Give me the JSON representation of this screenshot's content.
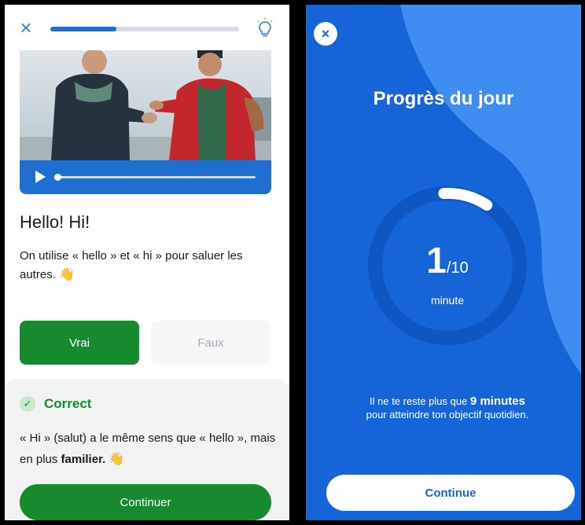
{
  "lesson_screen": {
    "close_icon": "close-icon",
    "progress_fraction": 0.35,
    "hint_icon": "lightbulb-icon",
    "video": {
      "play_icon": "play-icon",
      "seek_fraction": 0.0
    },
    "title": "Hello! Hi!",
    "body_text": "On utilise « hello » et « hi » pour saluer les autres.",
    "body_emoji": "👋",
    "answer_true_label": "Vrai",
    "answer_false_label": "Faux",
    "feedback": {
      "status_label": "Correct",
      "text_before": "« Hi » (salut) a le même sens que « hello », mais en plus ",
      "text_bold": "familier.",
      "emoji": "👋",
      "continue_label": "Continuer"
    },
    "colors": {
      "accent_blue": "#1f6fd1",
      "success_green": "#178a2f"
    }
  },
  "progress_screen": {
    "close_icon": "close-icon",
    "title": "Progrès du jour",
    "current_minutes": "1",
    "goal_minutes_label": "/10",
    "unit_label": "minute",
    "progress_fraction": 0.1,
    "message_prefix": "Il ne te reste plus que ",
    "message_bold": "9 minutes",
    "message_suffix": "pour atteindre ton objectif quotidien.",
    "continue_label": "Continue",
    "colors": {
      "background": "#1565d8",
      "wave": "#3d8ef0"
    }
  }
}
